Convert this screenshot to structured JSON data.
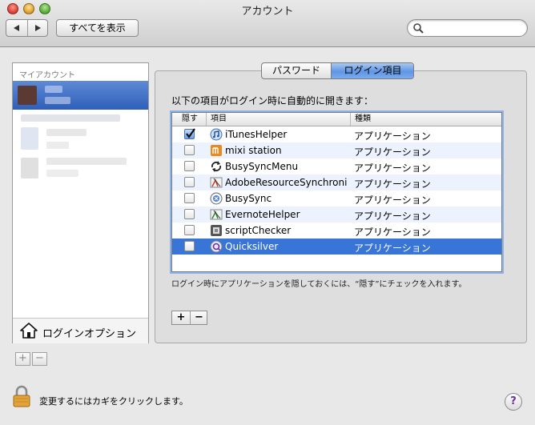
{
  "window": {
    "title": "アカウント"
  },
  "toolbar": {
    "show_all_label": "すべてを表示",
    "search_placeholder": ""
  },
  "sidebar": {
    "header": "マイアカウント",
    "login_options_label": "ログインオプション",
    "add_label": "+",
    "remove_label": "−"
  },
  "tabs": [
    {
      "label": "パスワード",
      "selected": false
    },
    {
      "label": "ログイン項目",
      "selected": true
    }
  ],
  "login_items": {
    "instruction": "以下の項目がログイン時に自動的に開きます：",
    "columns": {
      "hide": "隠す",
      "item": "項目",
      "kind": "種類"
    },
    "rows": [
      {
        "hide": true,
        "name": "iTunesHelper",
        "kind": "アプリケーション",
        "icon": "itunes-icon"
      },
      {
        "hide": false,
        "name": "mixi station",
        "kind": "アプリケーション",
        "icon": "mixi-icon"
      },
      {
        "hide": false,
        "name": "BusySyncMenu",
        "kind": "アプリケーション",
        "icon": "sync-arrows-icon"
      },
      {
        "hide": false,
        "name": "AdobeResourceSynchroni",
        "kind": "アプリケーション",
        "icon": "adobe-app-icon"
      },
      {
        "hide": false,
        "name": "BusySync",
        "kind": "アプリケーション",
        "icon": "busysync-icon"
      },
      {
        "hide": false,
        "name": "EvernoteHelper",
        "kind": "アプリケーション",
        "icon": "evernote-app-icon"
      },
      {
        "hide": false,
        "name": "scriptChecker",
        "kind": "アプリケーション",
        "icon": "script-app-icon"
      },
      {
        "hide": false,
        "name": "Quicksilver",
        "kind": "アプリケーション",
        "icon": "quicksilver-icon",
        "selected": true
      }
    ],
    "note": "ログイン時にアプリケーションを隠しておくには、“隠す”にチェックを入れます。",
    "add_label": "+",
    "remove_label": "−"
  },
  "footer": {
    "lock_text": "変更するにはカギをクリックします。",
    "help_label": "?"
  },
  "colors": {
    "selection": "#3875d7",
    "tab_selected": "#5e96e5",
    "alt_row": "#edf3fe"
  }
}
